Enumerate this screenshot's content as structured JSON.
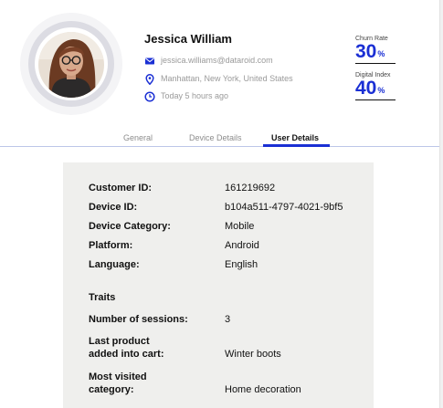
{
  "profile": {
    "name": "Jessica William",
    "email": "jessica.williams@dataroid.com",
    "location": "Manhattan, New York, United States",
    "last_seen": "Today 5 hours ago",
    "icons": {
      "email": "envelope-icon",
      "location": "map-pin-icon",
      "time": "clock-icon"
    }
  },
  "metrics": [
    {
      "label": "Churn Rate",
      "value": "30",
      "unit": "%"
    },
    {
      "label": "Digital Index",
      "value": "40",
      "unit": "%"
    }
  ],
  "tabs": [
    {
      "label": "General",
      "active": false
    },
    {
      "label": "Device Details",
      "active": false
    },
    {
      "label": "User Details",
      "active": true
    }
  ],
  "details": {
    "customer_id_label": "Customer ID:",
    "customer_id": "161219692",
    "device_id_label": "Device ID:",
    "device_id": "b104a511-4797-4021-9bf5",
    "device_category_label": "Device Category:",
    "device_category": "Mobile",
    "platform_label": "Platform:",
    "platform": "Android",
    "language_label": "Language:",
    "language": "English"
  },
  "traits": {
    "heading": "Traits",
    "sessions_label": "Number of sessions:",
    "sessions": "3",
    "last_product_label_line1": "Last product",
    "last_product_label_line2": "added into cart:",
    "last_product": "Winter boots",
    "most_visited_label_line1": "Most visited",
    "most_visited_label_line2": "category:",
    "most_visited": "Home decoration"
  },
  "colors": {
    "accent": "#1a2fd4",
    "panel_bg": "#efefed",
    "muted_text": "#9a9a9a"
  }
}
